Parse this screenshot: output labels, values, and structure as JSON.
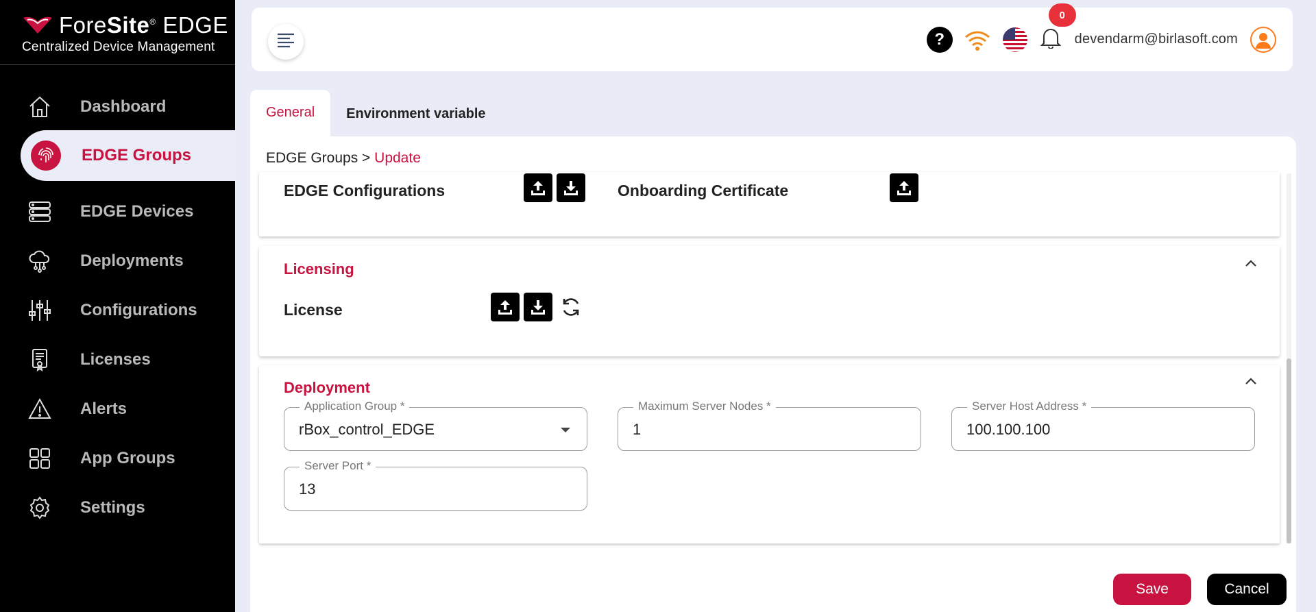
{
  "brand": {
    "name_light": "Fore",
    "name_bold": "Site",
    "reg": "®",
    "name_suffix": " EDGE",
    "tagline": "Centralized Device Management",
    "accent": "#c8123f"
  },
  "sidebar": {
    "items": [
      {
        "label": "Dashboard",
        "icon": "home-icon"
      },
      {
        "label": "EDGE Groups",
        "icon": "fingerprint-icon",
        "active": true
      },
      {
        "label": "EDGE Devices",
        "icon": "server-icon"
      },
      {
        "label": "Deployments",
        "icon": "cloud-network-icon"
      },
      {
        "label": "Configurations",
        "icon": "sliders-icon"
      },
      {
        "label": "Licenses",
        "icon": "certificate-icon"
      },
      {
        "label": "Alerts",
        "icon": "warning-icon"
      },
      {
        "label": "App Groups",
        "icon": "grid-icon"
      },
      {
        "label": "Settings",
        "icon": "gear-icon"
      }
    ]
  },
  "header": {
    "help": "?",
    "notification_count": "0",
    "user_email": "devendarm@birlasoft.com"
  },
  "tabs": [
    {
      "label": "General",
      "active": true
    },
    {
      "label": "Environment variable"
    }
  ],
  "breadcrumb": {
    "parent": "EDGE Groups",
    "separator": " > ",
    "current": "Update"
  },
  "configurations": {
    "edge_configurations_label": "EDGE Configurations",
    "onboarding_certificate_label": "Onboarding Certificate"
  },
  "licensing": {
    "title": "Licensing",
    "license_label": "License"
  },
  "deployment": {
    "title": "Deployment",
    "application_group": {
      "label": "Application Group *",
      "value": "rBox_control_EDGE"
    },
    "max_server_nodes": {
      "label": "Maximum Server Nodes *",
      "value": "1"
    },
    "server_host_address": {
      "label": "Server Host Address *",
      "value": "100.100.100"
    },
    "server_port": {
      "label": "Server Port *",
      "value": "13"
    }
  },
  "actions": {
    "save": "Save",
    "cancel": "Cancel"
  }
}
